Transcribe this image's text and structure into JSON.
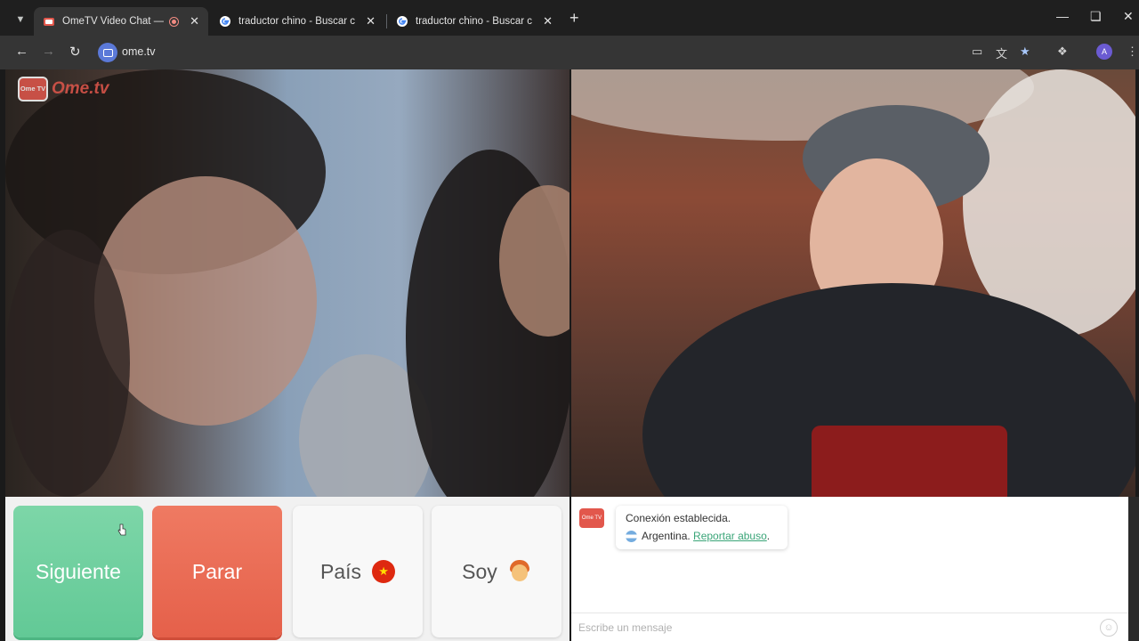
{
  "browser": {
    "tabs": [
      {
        "title": "OmeTV Video Chat — Ome",
        "active": true,
        "favicon": "ometv-favicon",
        "recording": true
      },
      {
        "title": "traductor chino - Buscar con G",
        "active": false,
        "favicon": "google-favicon"
      },
      {
        "title": "traductor chino - Buscar con G",
        "active": false,
        "favicon": "google-favicon"
      }
    ],
    "url": "ome.tv",
    "profile_initial": "A"
  },
  "site": {
    "logo_badge": "Ome TV",
    "logo_text": "Ome.tv"
  },
  "controls": {
    "next_label": "Siguiente",
    "stop_label": "Parar",
    "country_label": "País",
    "gender_label": "Soy",
    "country_flag_icon": "china-flag-icon",
    "gender_icon": "person-icon"
  },
  "chat": {
    "badge": "Ome TV",
    "status_message": "Conexión establecida.",
    "country": "Argentina.",
    "report_link": "Reportar abuso",
    "report_suffix": ".",
    "input_placeholder": "Escribe un mensaje"
  },
  "colors": {
    "next": "#62c996",
    "stop": "#e5604a",
    "brand": "#e2574c",
    "link": "#3aa578"
  }
}
